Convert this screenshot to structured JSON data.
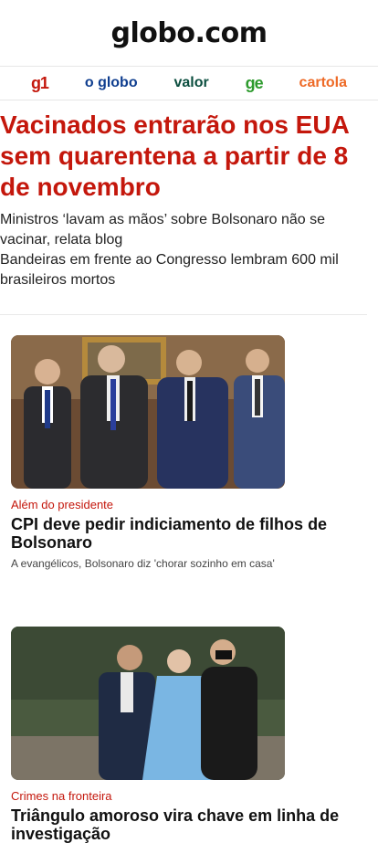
{
  "header": {
    "logo_text": "globo.com"
  },
  "brands": [
    {
      "label": "g1"
    },
    {
      "label": "o globo"
    },
    {
      "label": "valor"
    },
    {
      "label": "ge"
    },
    {
      "label": "cartola"
    }
  ],
  "main": {
    "headline": "Vacinados entrarão nos EUA sem quarentena a partir de 8 de novembro",
    "sublinks": [
      "Ministros ‘lavam as mãos’ sobre Bolsonaro não se vacinar, relata blog",
      "Bandeiras em frente ao Congresso lembram 600 mil brasileiros mortos"
    ]
  },
  "cards": [
    {
      "kicker": "Além do presidente",
      "title": "CPI deve pedir indiciamento de filhos de Bolsonaro",
      "sub": "A evangélicos, Bolsonaro diz 'chorar sozinho em casa'"
    },
    {
      "kicker": "Crimes na fronteira",
      "title": "Triângulo amoroso vira chave em linha de investigação",
      "sub": ""
    }
  ],
  "colors": {
    "accent_red": "#c4170c",
    "logo_blue": "#1f7bdc"
  }
}
